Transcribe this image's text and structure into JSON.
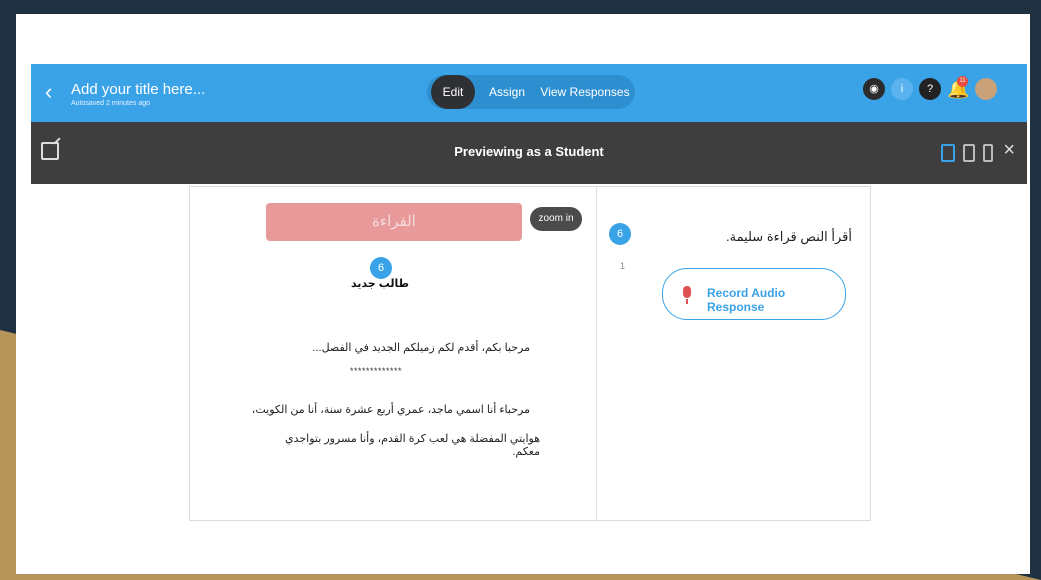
{
  "topbar": {
    "title": "Add your title here...",
    "autosave": "Autosaved 2 minutes ago",
    "tabs": [
      {
        "label": "Edit",
        "active": true
      },
      {
        "label": "Assign",
        "active": false
      },
      {
        "label": "View Responses",
        "active": false
      }
    ],
    "notification_count": "11",
    "colors": {
      "bar": "#3aa3e8",
      "segment": "#2e8fd0",
      "active_tab": "#2e3033"
    }
  },
  "preview_bar": {
    "title": "Previewing as a Student",
    "close_label": "×"
  },
  "left_panel": {
    "read_button_label": "القراءة",
    "zoom_label": "zoom in",
    "badge_number": "6",
    "heading": "طالب جديد",
    "line1": "مرحبا بكم، أقدم لكم زميلكم الجديد في الفصل...",
    "stars": "*************",
    "line2": "مرحباء أنا اسمي ماجد، عمري أربع عشرة سنة، أنا من الكويت،",
    "line3": "هوايتي المفضلة هي لعب كرة القدم، وأنا مسرور بتواجدي معكم."
  },
  "right_panel": {
    "question_number": "6",
    "question_index": "1",
    "instruction": "أقرأ النص قراءة سليمة.",
    "record_label": "Record Audio Response"
  }
}
